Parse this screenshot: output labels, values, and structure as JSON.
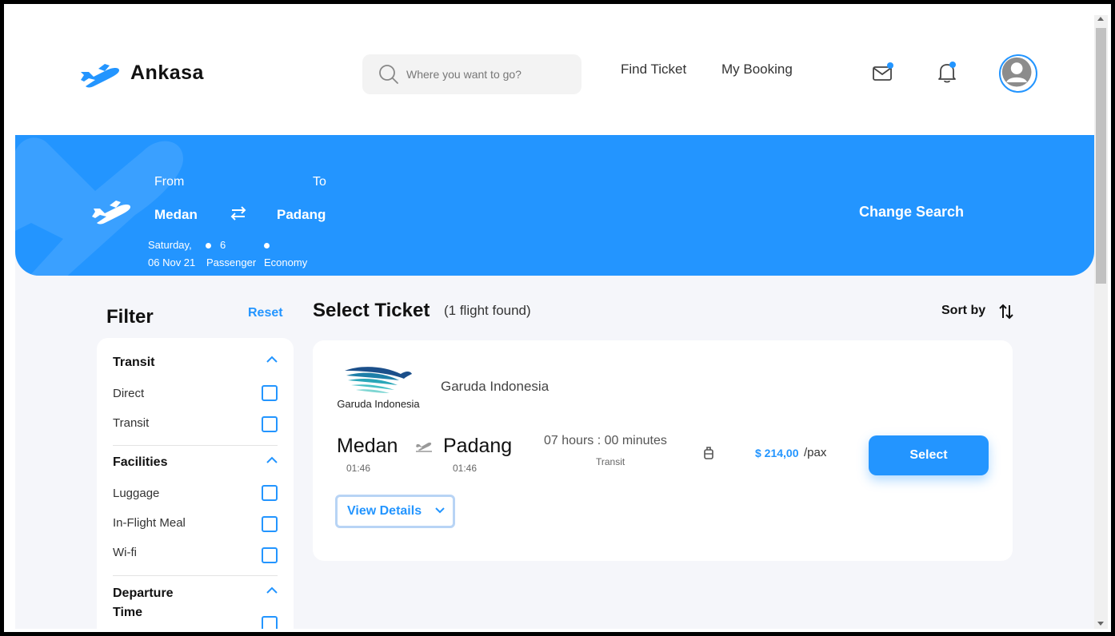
{
  "header": {
    "brand": "Ankasa",
    "search_placeholder": "Where you want to go?",
    "nav": [
      "Find Ticket",
      "My Booking"
    ]
  },
  "banner": {
    "from_label": "From",
    "to_label": "To",
    "from": "Medan",
    "to": "Padang",
    "day": "Saturday,",
    "date": "06 Nov 21",
    "passenger_count": "6",
    "passenger_label": "Passenger",
    "class": "Economy",
    "change_search": "Change Search"
  },
  "filter": {
    "title": "Filter",
    "reset": "Reset",
    "sections": [
      {
        "title": "Transit",
        "items": [
          "Direct",
          "Transit"
        ]
      },
      {
        "title": "Facilities",
        "items": [
          "Luggage",
          "In-Flight Meal",
          "Wi-fi"
        ]
      },
      {
        "title": "Departure Time",
        "items": []
      }
    ]
  },
  "tickets": {
    "title": "Select Ticket",
    "count": "(1 flight found)",
    "sort_label": "Sort by",
    "results": [
      {
        "airline_logo_text": "Garuda Indonesia",
        "airline": "Garuda Indonesia",
        "from": "Medan",
        "to": "Padang",
        "depart_time": "01:46",
        "arrive_time": "01:46",
        "duration": "07 hours : 00 minutes",
        "transit": "Transit",
        "price": "$ 214,00",
        "price_unit": "/pax",
        "select_label": "Select",
        "details_label": "View Details"
      }
    ]
  },
  "colors": {
    "accent": "#2395ff",
    "background": "#f5f6fa"
  }
}
